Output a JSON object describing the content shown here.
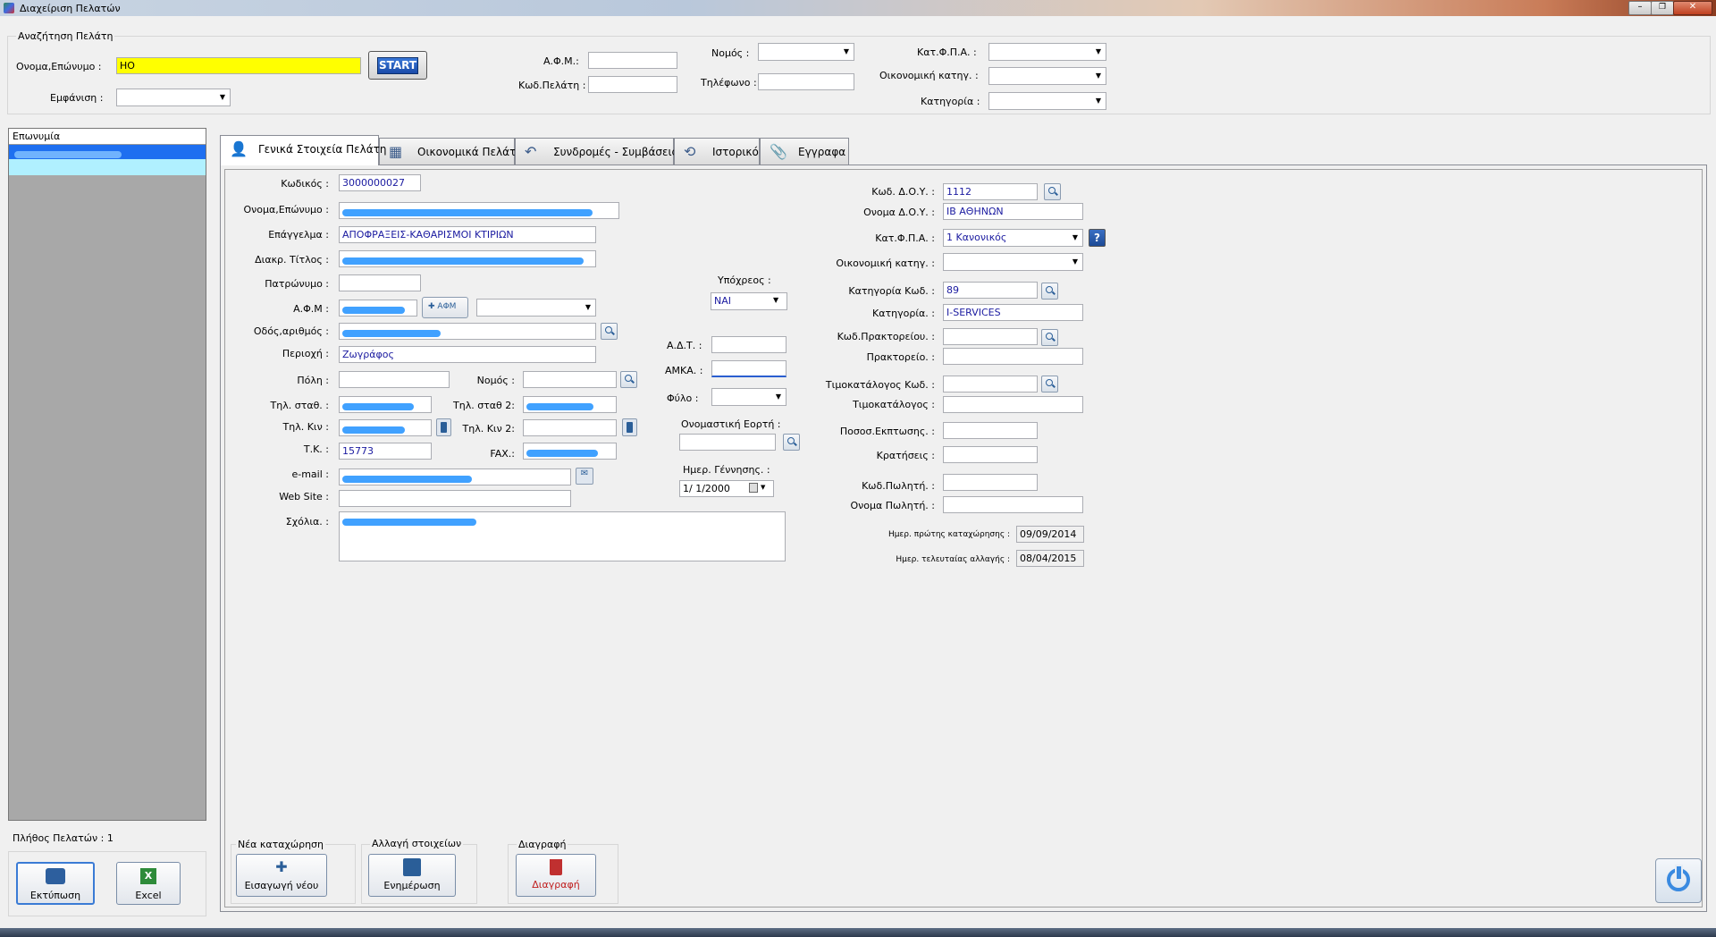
{
  "window": {
    "title": "Διαχείριση Πελατών"
  },
  "search": {
    "group_title": "Αναζήτηση Πελάτη",
    "name_label": "Ονομα,Επώνυμο :",
    "name_value": "ΗΟ",
    "start_label": "START",
    "display_label": "Εμφάνιση :",
    "afm_label": "Α.Φ.Μ.:",
    "code_label": "Κωδ.Πελάτη :",
    "nomos_label": "Νομός :",
    "phone_label": "Τηλέφωνο :",
    "vat_label": "Κατ.Φ.Π.Α. :",
    "econ_label": "Οικονομική κατηγ. :",
    "cat_label": "Κατηγορία :"
  },
  "list": {
    "header": "Επωνυμία",
    "count_label": "Πλήθος Πελατών : 1",
    "print_label": "Εκτύπωση",
    "excel_label": "Excel"
  },
  "tabs": [
    {
      "label": "Γενικά Στοιχεία Πελάτη"
    },
    {
      "label": "Οικονομικά Πελάτη"
    },
    {
      "label": "Συνδρομές - Συμβάσεις"
    },
    {
      "label": "Ιστορικό"
    },
    {
      "label": "Εγγραφα"
    }
  ],
  "form": {
    "code_label": "Κωδικός :",
    "code_value": "3000000027",
    "name_label": "Ονομα,Επώνυμο :",
    "job_label": "Επάγγελμα :",
    "job_value": "ΑΠΟΦΡΑΞΕΙΣ-ΚΑΘΑΡΙΣΜΟΙ ΚΤΙΡΙΩΝ",
    "title_label": "Διακρ. Τίτλος :",
    "father_label": "Πατρώνυμο :",
    "afm_label": "Α.Φ.Μ :",
    "afm_btn": "ΑΦΜ",
    "street_label": "Οδός,αριθμός :",
    "area_label": "Περιοχή :",
    "area_value": "Ζωγράφος",
    "city_label": "Πόλη :",
    "nomos_label": "Νομός :",
    "tel_label": "Τηλ. σταθ. :",
    "tel2_label": "Τηλ. σταθ 2:",
    "mob_label": "Τηλ. Κιν :",
    "mob2_label": "Τηλ. Κιν 2:",
    "tk_label": "Τ.Κ. :",
    "tk_value": "15773",
    "fax_label": "FAX.:",
    "email_label": "e-mail :",
    "web_label": "Web Site :",
    "notes_label": "Σχόλια. :",
    "obliged_label": "Υπόχρεος :",
    "obliged_value": "ΝΑΙ",
    "adt_label": "Α.Δ.Τ. :",
    "amka_label": "ΑΜΚΑ. :",
    "gender_label": "Φύλο :",
    "nameday_label": "Ονομαστική Εορτή :",
    "birth_label": "Ημερ. Γέννησης. :",
    "birth_value": "1/  1/2000",
    "doy_code_label": "Κωδ. Δ.Ο.Υ. :",
    "doy_code_value": "1112",
    "doy_name_label": "Ονομα Δ.Ο.Υ. :",
    "doy_name_value": "ΙΒ ΑΘΗΝΩΝ",
    "vat_label": "Κατ.Φ.Π.Α. :",
    "vat_value": "1 Κανονικός",
    "econ_label": "Οικονομική κατηγ. :",
    "cat_code_label": "Κατηγορία Κωδ. :",
    "cat_code_value": "89",
    "cat_label": "Κατηγορία. :",
    "cat_value": "I-SERVICES",
    "office_code_label": "Κωδ.Πρακτορείου. :",
    "office_label": "Πρακτορείο. :",
    "price_code_label": "Τιμοκατάλογος Κωδ. :",
    "price_label": "Τιμοκατάλογος :",
    "discount_label": "Ποσοσ.Εκπτωσης. :",
    "hold_label": "Κρατήσεις :",
    "seller_code_label": "Κωδ.Πωλητή. :",
    "seller_name_label": "Ονομα Πωλητή. :",
    "first_date_label": "Ημερ. πρώτης καταχώρησης :",
    "first_date_value": "09/09/2014",
    "last_date_label": "Ημερ. τελευταίας αλλαγής :",
    "last_date_value": "08/04/2015"
  },
  "actions": {
    "new_group": "Νέα καταχώρηση",
    "new_btn": "Εισαγωγή νέου",
    "edit_group": "Αλλαγή στοιχείων",
    "edit_btn": "Ενημέρωση",
    "del_group": "Διαγραφή",
    "del_btn": "Διαγραφή"
  },
  "colors": {
    "highlight": "#ffff00",
    "selection": "#b0f0ff",
    "field_text": "#1a1aa0"
  }
}
